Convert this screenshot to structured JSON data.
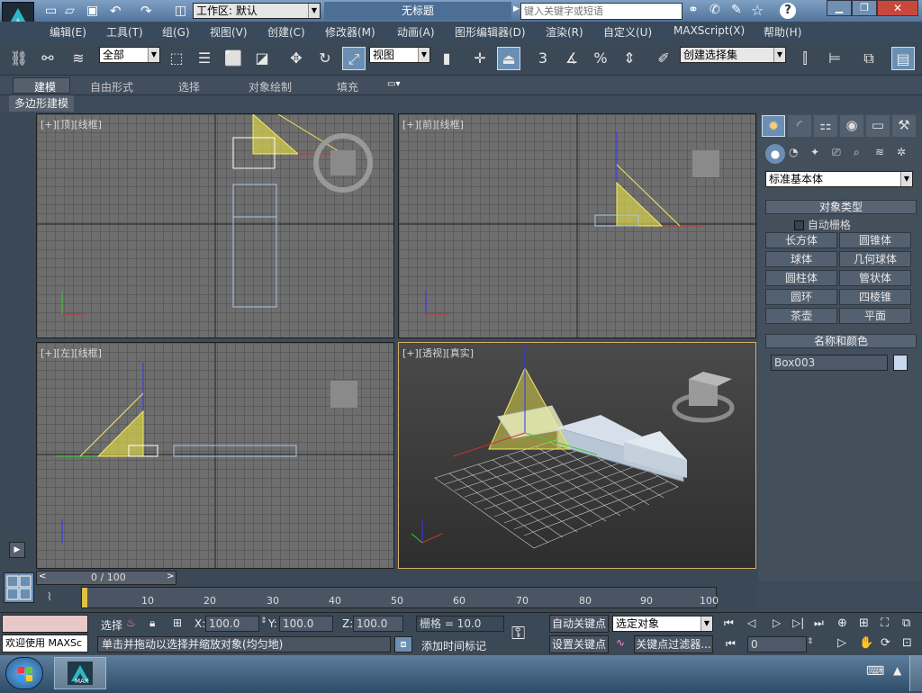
{
  "title_bar": {
    "workspace_label": "工作区: 默认",
    "doc_title": "无标题",
    "search_placeholder": "键入关键字或短语",
    "min_icon": "minimize-icon",
    "max_icon": "maximize-icon",
    "close_icon": "close-icon"
  },
  "menu": [
    "编辑(E)",
    "工具(T)",
    "组(G)",
    "视图(V)",
    "创建(C)",
    "修改器(M)",
    "动画(A)",
    "图形编辑器(D)",
    "渲染(R)",
    "自定义(U)",
    "MAXScript(X)",
    "帮助(H)"
  ],
  "toolbar": {
    "selection_filter": "全部",
    "ref_coord": "视图",
    "named_selection": "创建选择集",
    "snap_label": "3",
    "angle_snap": "%"
  },
  "ribbon": {
    "tabs": [
      "建模",
      "自由形式",
      "选择",
      "对象绘制",
      "填充"
    ],
    "sub_label": "多边形建模"
  },
  "viewports": {
    "top": "[+][顶][线框]",
    "front": "[+][前][线框]",
    "left": "[+][左][线框]",
    "persp_plus": "[+]",
    "persp_name": "[透视]",
    "persp_shade": "[真实]"
  },
  "cmd_panel": {
    "category": "标准基本体",
    "rollout_object_type": "对象类型",
    "autogrid": "自动栅格",
    "buttons": [
      "长方体",
      "圆锥体",
      "球体",
      "几何球体",
      "圆柱体",
      "管状体",
      "圆环",
      "四棱锥",
      "茶壶",
      "平面"
    ],
    "rollout_name_color": "名称和颜色",
    "object_name": "Box003",
    "object_color": "#c8d8ee"
  },
  "timeline": {
    "frame_counter": "0 / 100",
    "ticks": [
      "10",
      "20",
      "30",
      "40",
      "50",
      "60",
      "70",
      "80",
      "90",
      "100"
    ]
  },
  "status": {
    "welcome": "欢迎使用 MAXSc",
    "select_label": "选择",
    "x_label": "X:",
    "x_value": "100.0",
    "y_label": "Y:",
    "y_value": "100.0",
    "z_label": "Z:",
    "z_value": "100.0",
    "grid_label": "栅格 = 10.0",
    "prompt": "单击并拖动以选择并缩放对象(均匀地)",
    "add_time_tag": "添加时间标记",
    "auto_key": "自动关键点",
    "set_key": "设置关键点",
    "key_filter_select": "选定对象",
    "key_filters": "关键点过滤器...",
    "current_frame": "0"
  },
  "taskbar": {
    "app_badge": "MAX"
  }
}
